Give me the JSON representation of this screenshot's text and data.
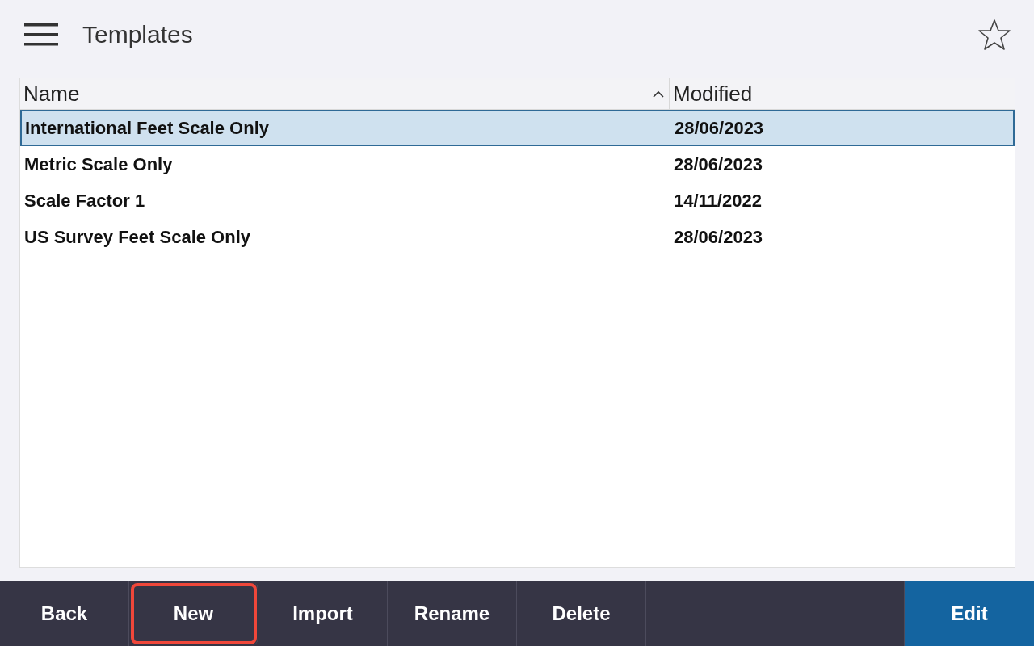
{
  "header": {
    "title": "Templates",
    "favorite": false
  },
  "table": {
    "columns": [
      {
        "label": "Name",
        "sorted": true
      },
      {
        "label": "Modified",
        "sorted": false
      }
    ],
    "rows": [
      {
        "name": "International Feet Scale Only",
        "modified": "28/06/2023",
        "selected": true
      },
      {
        "name": "Metric Scale Only",
        "modified": "28/06/2023",
        "selected": false
      },
      {
        "name": "Scale Factor 1",
        "modified": "14/11/2022",
        "selected": false
      },
      {
        "name": "US Survey Feet Scale Only",
        "modified": "28/06/2023",
        "selected": false
      }
    ]
  },
  "toolbar": [
    {
      "kind": "normal",
      "label": "Back",
      "highlighted": false
    },
    {
      "kind": "normal",
      "label": "New",
      "highlighted": true
    },
    {
      "kind": "normal",
      "label": "Import",
      "highlighted": false
    },
    {
      "kind": "normal",
      "label": "Rename",
      "highlighted": false
    },
    {
      "kind": "normal",
      "label": "Delete",
      "highlighted": false
    },
    {
      "kind": "empty",
      "highlighted": false
    },
    {
      "kind": "empty",
      "highlighted": false
    },
    {
      "kind": "primary",
      "label": "Edit",
      "highlighted": false
    }
  ]
}
